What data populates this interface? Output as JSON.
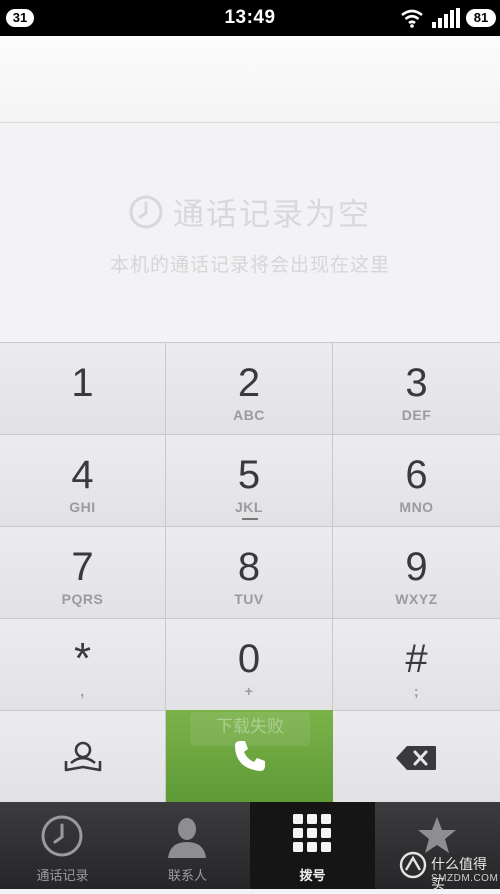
{
  "status_bar": {
    "notification_badge": "31",
    "time": "13:49",
    "battery": "81",
    "icons": [
      "wifi-icon",
      "signal-icon"
    ]
  },
  "number_input": {
    "value": ""
  },
  "call_log_empty": {
    "icon": "clock-icon",
    "title": "通话记录为空",
    "subtitle": "本机的通话记录将会出现在这里"
  },
  "keypad": {
    "keys": [
      {
        "digit": "1",
        "letters": ""
      },
      {
        "digit": "2",
        "letters": "ABC"
      },
      {
        "digit": "3",
        "letters": "DEF"
      },
      {
        "digit": "4",
        "letters": "GHI"
      },
      {
        "digit": "5",
        "letters": "JKL"
      },
      {
        "digit": "6",
        "letters": "MNO"
      },
      {
        "digit": "7",
        "letters": "PQRS"
      },
      {
        "digit": "8",
        "letters": "TUV"
      },
      {
        "digit": "9",
        "letters": "WXYZ"
      },
      {
        "digit": "*",
        "letters": ","
      },
      {
        "digit": "0",
        "letters": "+"
      },
      {
        "digit": "#",
        "letters": ";"
      }
    ],
    "call_overlay_text": "下载失败",
    "accent_color": "#6aa63e"
  },
  "tab_bar": {
    "tabs": [
      {
        "label": "通话记录",
        "icon": "clock-icon",
        "active": false
      },
      {
        "label": "联系人",
        "icon": "person-icon",
        "active": false
      },
      {
        "label": "拨号",
        "icon": "keypad-grid-icon",
        "active": true
      },
      {
        "label": "",
        "icon": "star-icon",
        "active": false
      }
    ]
  },
  "watermark": {
    "line1": "什么值得买",
    "line2": "SMZDM.COM"
  }
}
